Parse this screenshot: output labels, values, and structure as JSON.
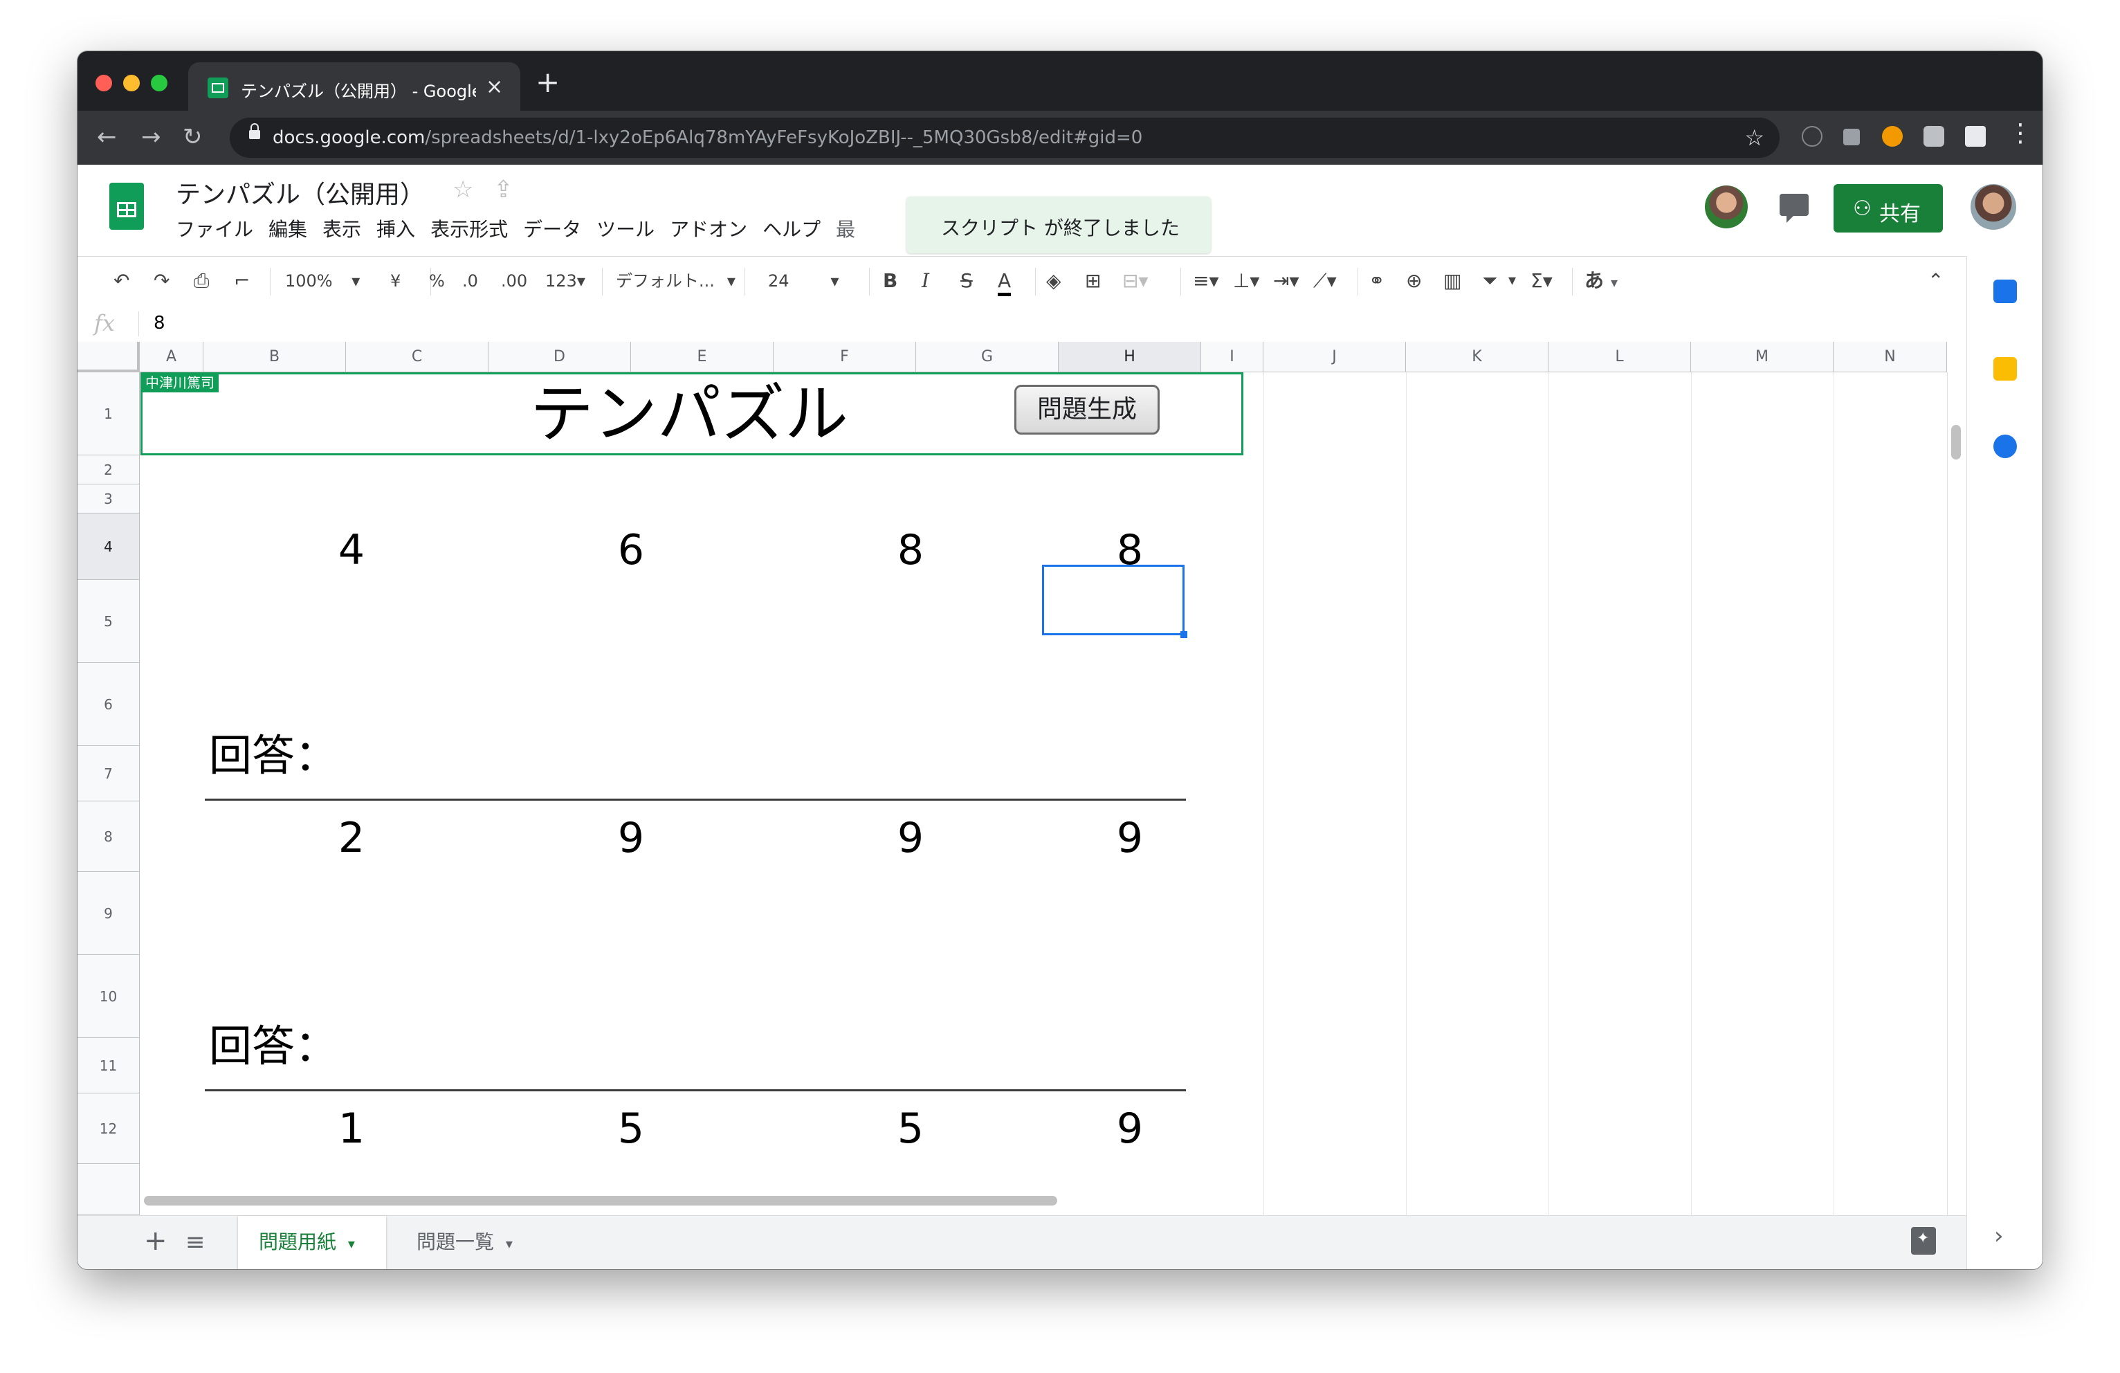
{
  "browser": {
    "tab_title": "テンパズル（公開用） - Google ス",
    "tab_close": "×",
    "new_tab": "+",
    "url_host": "docs.google.com",
    "url_path": "/spreadsheets/d/1-lxy2oEp6Alq78mYAyFeFsyKoJoZBIJ--_5MQ30Gsb8/edit#gid=0"
  },
  "app": {
    "doc_title": "テンパズル（公開用）",
    "menu": [
      "ファイル",
      "編集",
      "表示",
      "挿入",
      "表示形式",
      "データ",
      "ツール",
      "アドオン",
      "ヘルプ",
      "最"
    ],
    "toast": "スクリプト が終了しました",
    "share_label": "共有"
  },
  "toolbar": {
    "zoom": "100%",
    "currency": "¥",
    "percent": "%",
    "dec_less": ".0",
    "dec_more": ".00",
    "number_format": "123",
    "font": "デフォルト...",
    "font_size": "24",
    "bold": "B",
    "italic": "I",
    "strike": "S",
    "text_color": "A",
    "input_tool": "あ"
  },
  "formula_bar": {
    "value": "8"
  },
  "grid": {
    "columns": [
      "A",
      "B",
      "C",
      "D",
      "E",
      "F",
      "G",
      "H",
      "I",
      "J",
      "K",
      "L",
      "M",
      "N"
    ],
    "rows": [
      "1",
      "2",
      "3",
      "4",
      "5",
      "6",
      "7",
      "8",
      "9",
      "10",
      "11",
      "12"
    ],
    "collaborator_badge": "中津川篤司",
    "title": "テンパズル",
    "button_label": "問題生成",
    "puzzles": [
      {
        "numbers": [
          "4",
          "6",
          "8",
          "8"
        ],
        "answer_label": "回答："
      },
      {
        "numbers": [
          "2",
          "9",
          "9",
          "9"
        ],
        "answer_label": "回答："
      },
      {
        "numbers": [
          "1",
          "5",
          "5",
          "9"
        ]
      }
    ]
  },
  "sheets": {
    "active": "問題用紙",
    "other": "問題一覧"
  },
  "colors": {
    "accent_green": "#188038",
    "sheets_green": "#0f9d58",
    "selection_blue": "#1a73e8"
  }
}
